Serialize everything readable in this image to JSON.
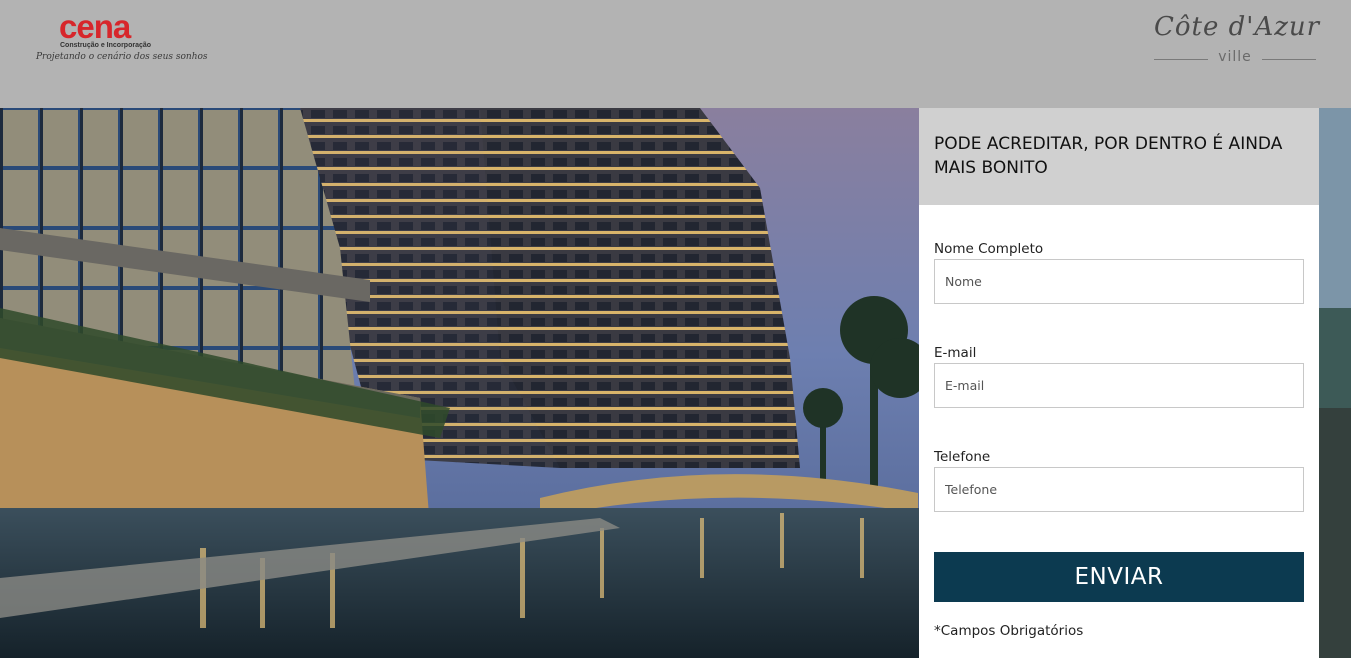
{
  "header": {
    "cena_logo": {
      "name": "cena",
      "subtitle": "Construção e Incorporação",
      "tagline": "Projetando o cenário dos seus sonhos"
    },
    "cote_logo": {
      "name": "Côte d'Azur",
      "sub": "ville"
    }
  },
  "hero": {
    "image": "resort-building-at-dusk-with-pool-and-bridge"
  },
  "form": {
    "title": "PODE ACREDITAR, POR DENTRO É AINDA MAIS BONITO",
    "fields": [
      {
        "label": "Nome Completo",
        "placeholder": "Nome"
      },
      {
        "label": "E-mail",
        "placeholder": "E-mail"
      },
      {
        "label": "Telefone",
        "placeholder": "Telefone"
      }
    ],
    "submit_label": "ENVIAR",
    "required_note": "*Campos Obrigatórios"
  },
  "colors": {
    "header_bg": "#b3b3b3",
    "button_bg": "#0c3a50",
    "brand_red": "#d7262b",
    "form_head_bg": "#d0d0d0"
  }
}
